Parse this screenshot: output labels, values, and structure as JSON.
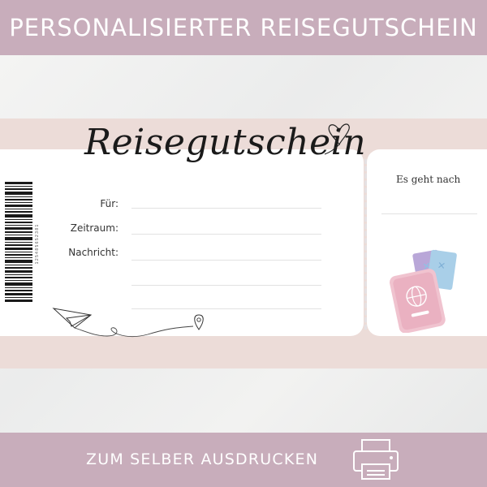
{
  "header": {
    "title": "PERSONALISIERTER REISEGUTSCHEIN"
  },
  "voucher": {
    "title": "Reisegutschein",
    "fields": [
      {
        "label": "Für:"
      },
      {
        "label": "Zeitraum:"
      },
      {
        "label": "Nachricht:"
      }
    ],
    "barcode_number": "1 2 5 4 8 5 6 5 2 3 8 1",
    "destination_label": "Es geht nach"
  },
  "footer": {
    "text": "ZUM SELBER AUSDRUCKEN"
  },
  "colors": {
    "banner": "#c8adbb",
    "ticket_frame": "#ecdcd8",
    "passport_pink": "#eab9c6",
    "ticket_blue": "#a9cfe8",
    "ticket_purple": "#b9a7d8"
  },
  "icons": [
    "heart-icon",
    "barcode-icon",
    "paper-plane-icon",
    "location-pin-icon",
    "passport-icon",
    "printer-icon"
  ]
}
